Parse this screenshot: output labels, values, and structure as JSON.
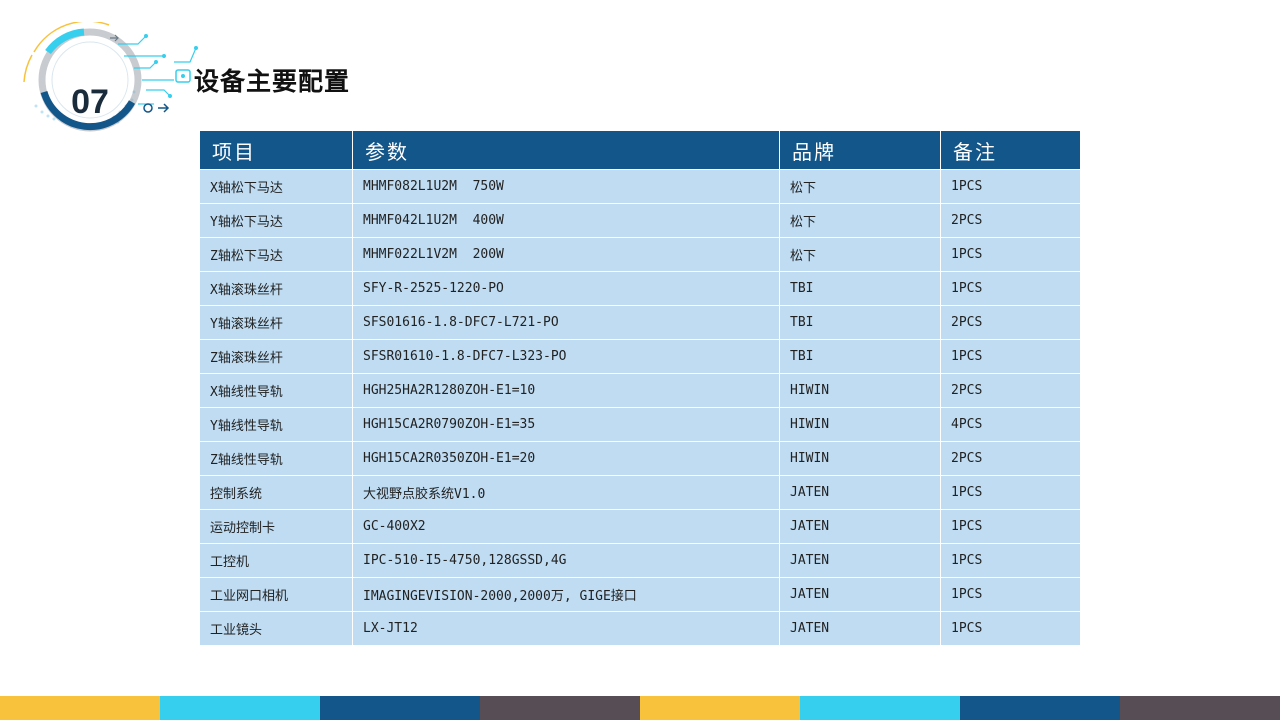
{
  "header": {
    "number": "07",
    "title": "设备主要配置"
  },
  "table": {
    "headers": [
      "项目",
      "参数",
      "品牌",
      "备注"
    ],
    "rows": [
      [
        "X轴松下马达",
        "MHMF082L1U2M  750W",
        "松下",
        "1PCS"
      ],
      [
        "Y轴松下马达",
        "MHMF042L1U2M  400W",
        "松下",
        "2PCS"
      ],
      [
        "Z轴松下马达",
        "MHMF022L1V2M  200W",
        "松下",
        "1PCS"
      ],
      [
        "X轴滚珠丝杆",
        "SFY-R-2525-1220-PO",
        "TBI",
        "1PCS"
      ],
      [
        "Y轴滚珠丝杆",
        "SFS01616-1.8-DFC7-L721-PO",
        "TBI",
        "2PCS"
      ],
      [
        "Z轴滚珠丝杆",
        "SFSR01610-1.8-DFC7-L323-PO",
        "TBI",
        "1PCS"
      ],
      [
        "X轴线性导轨",
        "HGH25HA2R1280ZOH-E1=10",
        "HIWIN",
        "2PCS"
      ],
      [
        "Y轴线性导轨",
        "HGH15CA2R0790ZOH-E1=35",
        "HIWIN",
        "4PCS"
      ],
      [
        "Z轴线性导轨",
        "HGH15CA2R0350ZOH-E1=20",
        "HIWIN",
        "2PCS"
      ],
      [
        "控制系统",
        "大视野点胶系统V1.0",
        "JATEN",
        "1PCS"
      ],
      [
        "运动控制卡",
        "GC-400X2",
        "JATEN",
        "1PCS"
      ],
      [
        "工控机",
        "IPC-510-I5-4750,128GSSD,4G",
        "JATEN",
        "1PCS"
      ],
      [
        "工业网口相机",
        "IMAGINGEVISION-2000,2000万, GIGE接口",
        "JATEN",
        "1PCS"
      ],
      [
        "工业镜头",
        "LX-JT12",
        "JATEN",
        "1PCS"
      ]
    ]
  },
  "colors": {
    "header_bg": "#135689",
    "row_bg": "#bfdcf2",
    "accent_yellow": "#f9c23c",
    "accent_cyan": "#36cfee",
    "accent_navy": "#135689",
    "accent_gray": "#574d55"
  },
  "footer_stripes": [
    "#f9c23c",
    "#36cfee",
    "#135689",
    "#574d55",
    "#f9c23c",
    "#36cfee",
    "#135689",
    "#574d55"
  ]
}
